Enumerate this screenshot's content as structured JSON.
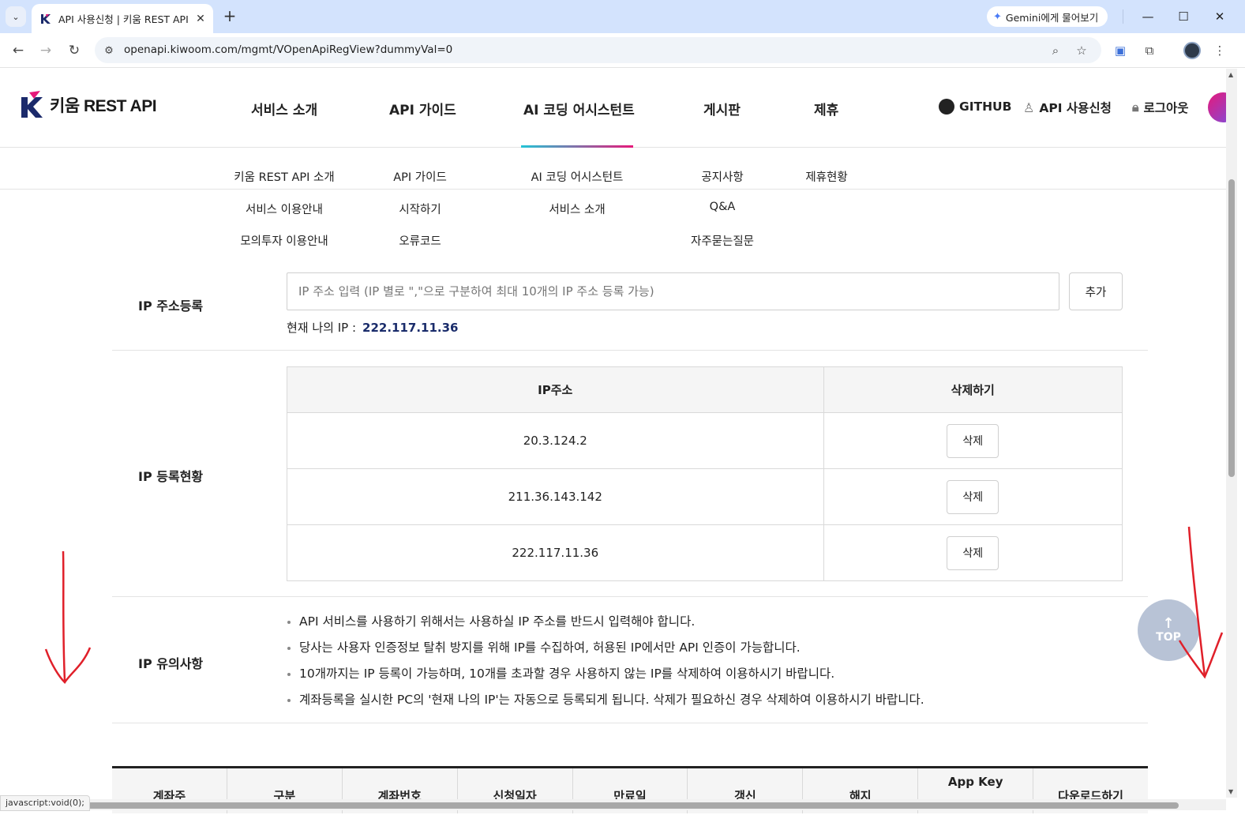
{
  "browser": {
    "tab_title": "API 사용신청 | 키움 REST API",
    "gemini_label": "Gemini에게 물어보기",
    "url": "openapi.kiwoom.com/mgmt/VOpenApiRegView?dummyVal=0",
    "status_tip": "javascript:void(0);"
  },
  "header": {
    "logo_text": "키움 REST API",
    "nav": [
      "서비스 소개",
      "API 가이드",
      "AI 코딩 어시스턴트",
      "게시판",
      "제휴"
    ],
    "util": {
      "github": "GITHUB",
      "apply": "API 사용신청",
      "logout": "로그아웃"
    }
  },
  "submenu": {
    "col1": [
      "키움 REST API 소개",
      "서비스 이용안내",
      "모의투자 이용안내"
    ],
    "col2": [
      "API 가이드",
      "시작하기",
      "오류코드"
    ],
    "col3": [
      "AI 코딩 어시스턴트",
      "서비스 소개"
    ],
    "col4": [
      "공지사항",
      "Q&A",
      "자주묻는질문"
    ],
    "col5": [
      "제휴현황"
    ]
  },
  "ip_register": {
    "label": "IP 주소등록",
    "placeholder": "IP 주소 입력 (IP 별로 \",\"으로 구분하여 최대 10개의 IP 주소 등록 가능)",
    "add_label": "추가",
    "my_ip_label": "현재 나의 IP :",
    "my_ip_value": "222.117.11.36"
  },
  "ip_status": {
    "label": "IP 등록현황",
    "columns": [
      "IP주소",
      "삭제하기"
    ],
    "rows": [
      "20.3.124.2",
      "211.36.143.142",
      "222.117.11.36"
    ],
    "delete_label": "삭제"
  },
  "ip_notice": {
    "label": "IP 유의사항",
    "items": [
      "API 서비스를 사용하기 위해서는 사용하실 IP 주소를 반드시 입력해야 합니다.",
      "당사는 사용자 인증정보 탈취 방지를 위해 IP를 수집하여, 허용된 IP에서만 API 인증이 가능합니다.",
      "10개까지는 IP 등록이 가능하며, 10개를 초과할 경우 사용하지 않는 IP를 삭제하여 이용하시기 바랍니다.",
      "계좌등록을 실시한 PC의 '현재 나의 IP'는 자동으로 등록되게 됩니다. 삭제가 필요하신 경우 삭제하여 이용하시기 바랍니다."
    ]
  },
  "bottom_table_headers": [
    "계좌주",
    "구분",
    "계좌번호",
    "신청일자",
    "만료일",
    "갱신",
    "해지",
    "App Key",
    "다운로드하기"
  ],
  "top_button": "TOP",
  "colors": {
    "accent_navy": "#1a2c6b",
    "brand_pink": "#e6197a",
    "brand_cyan": "#23c4d6",
    "annotation_red": "#e0202a"
  }
}
